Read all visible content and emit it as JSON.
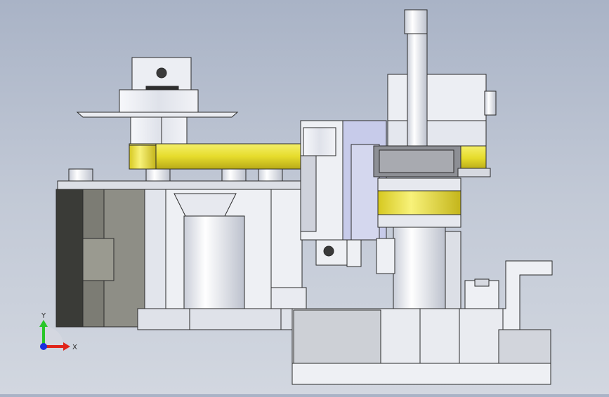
{
  "viewport": {
    "background_top": "#a9b3c6",
    "background_bottom": "#d2d7e0"
  },
  "model": {
    "colors": {
      "steel": "#e8eaf0",
      "steel_dark": "#c9ccd6",
      "edge": "#2b2b2b",
      "brass": "#e8e23a",
      "brass_dark": "#b8aa18",
      "motor_dark": "#3a3b37",
      "motor_mid": "#7c7c74",
      "motor_light": "#9a9a90",
      "blue_steel": "#c7cbea"
    }
  },
  "triad": {
    "x_label": "X",
    "y_label": "Y",
    "x_color": "#e0241a",
    "y_color": "#28c628",
    "z_color": "#1a2ee0"
  }
}
